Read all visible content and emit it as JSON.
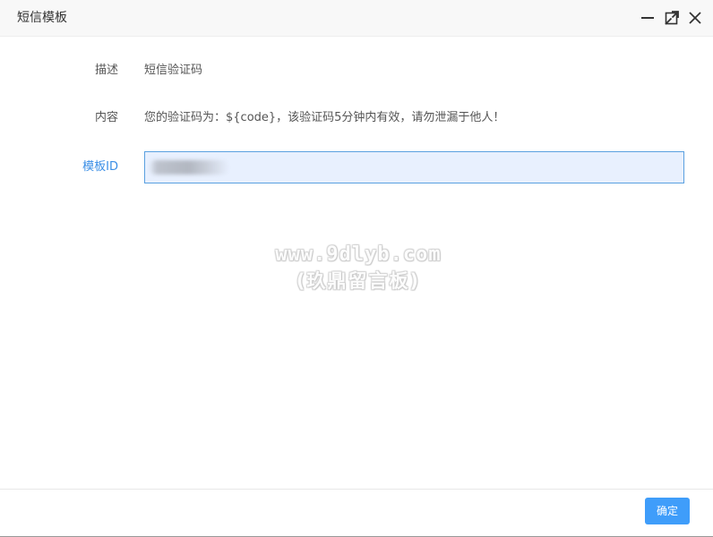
{
  "dialog": {
    "title": "短信模板",
    "controls": {
      "minimize_icon": "minimize-icon",
      "maximize_icon": "maximize-icon",
      "close_icon": "close-icon"
    }
  },
  "form": {
    "description": {
      "label": "描述",
      "value": "短信验证码"
    },
    "content": {
      "label": "内容",
      "value": "您的验证码为：${code}，该验证码5分钟内有效，请勿泄漏于他人！"
    },
    "template_id": {
      "label": "模板ID",
      "value": ""
    }
  },
  "watermark": {
    "line1": "www.9dlyb.com",
    "line2": "(玖鼎留言板)"
  },
  "footer": {
    "confirm_label": "确定"
  },
  "colors": {
    "accent": "#3f9dfa",
    "label_active": "#3a8ee6",
    "input_bg": "#e8f0fe"
  }
}
